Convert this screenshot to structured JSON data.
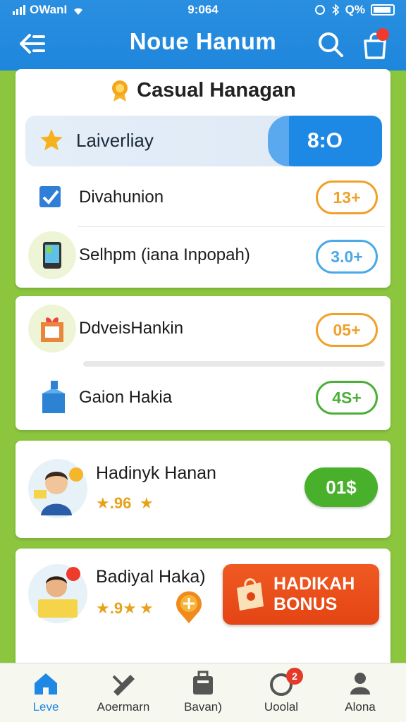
{
  "status_bar": {
    "carrier": "OWanI",
    "time": "9:064",
    "battery": "Q%"
  },
  "header": {
    "title": "Noue Hanum"
  },
  "section1": {
    "title": "Casual Hanagan",
    "highlight": {
      "label": "Laiverliay",
      "value": "8:O"
    },
    "rows": [
      {
        "label": "Divahunion",
        "value": "13+",
        "color": "#f0a12b"
      },
      {
        "label": "Selhpm (iana Inpopah)",
        "value": "3.0+",
        "color": "#49a9e8"
      }
    ]
  },
  "section2": {
    "rows": [
      {
        "label": "DdveisHankin",
        "value": "05+",
        "color": "#f0a12b"
      },
      {
        "label": "Gaion Hakia",
        "value": "4S+",
        "color": "#4caf38"
      }
    ]
  },
  "section3": {
    "name": "Hadinyk Hanan",
    "rating_text": "★.96",
    "button": "01$"
  },
  "section4": {
    "name": "Badiyal Haka)",
    "rating_text": "★.9★",
    "bonus_line1": "HADIKAH",
    "bonus_line2": "BONUS"
  },
  "bottom_nav": {
    "items": [
      {
        "label": "Leve",
        "icon": "home-icon"
      },
      {
        "label": "Aoermarn",
        "icon": "pen-icon"
      },
      {
        "label": "Bavan)",
        "icon": "briefcase-icon"
      },
      {
        "label": "Uoolal",
        "icon": "compass-icon",
        "badge": "2"
      },
      {
        "label": "Alona",
        "icon": "profile-icon"
      }
    ]
  }
}
